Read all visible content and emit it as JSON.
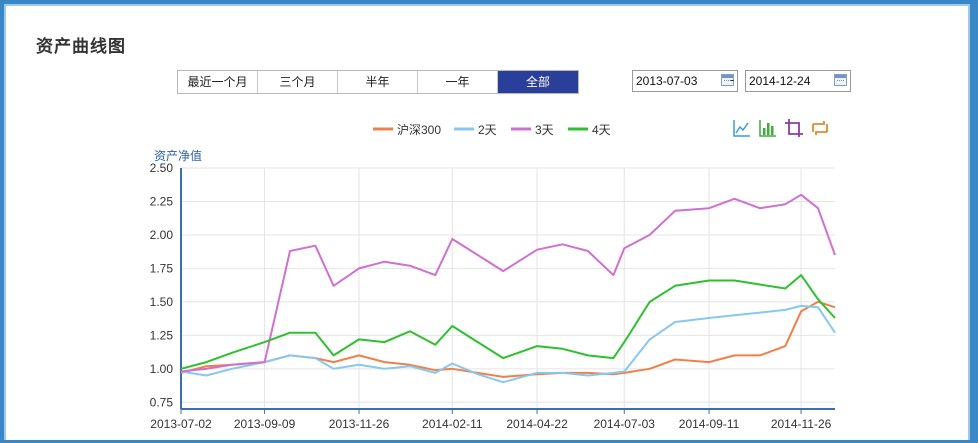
{
  "panel": {
    "title": "资产曲线图"
  },
  "range_tabs": [
    {
      "label": "最近一个月",
      "active": false
    },
    {
      "label": "三个月",
      "active": false
    },
    {
      "label": "半年",
      "active": false
    },
    {
      "label": "一年",
      "active": false
    },
    {
      "label": "全部",
      "active": true
    }
  ],
  "date_range": {
    "start": "2013-07-03",
    "separator": "-",
    "end": "2014-12-24"
  },
  "toolbox_icons": [
    "line-chart-icon",
    "bar-chart-icon",
    "stack-icon",
    "tiled-icon"
  ],
  "chart_data": {
    "type": "line",
    "ylabel": "资产净值",
    "ylim": [
      0.7,
      2.5
    ],
    "yticks": [
      "2.50",
      "2.25",
      "2.00",
      "1.75",
      "1.50",
      "1.25",
      "1.00",
      "0.75"
    ],
    "xticks": [
      "2013-07-02",
      "2013-09-09",
      "2013-11-26",
      "2014-02-11",
      "2014-04-22",
      "2014-07-03",
      "2014-09-11",
      "2014-11-26"
    ],
    "grid": true,
    "legend_position": "top-center",
    "x": [
      "2013-07-02",
      "2013-07-23",
      "2013-08-13",
      "2013-09-09",
      "2013-09-30",
      "2013-10-21",
      "2013-11-05",
      "2013-11-26",
      "2013-12-17",
      "2014-01-07",
      "2014-01-28",
      "2014-02-11",
      "2014-03-04",
      "2014-03-25",
      "2014-04-22",
      "2014-05-13",
      "2014-06-03",
      "2014-06-24",
      "2014-07-03",
      "2014-07-24",
      "2014-08-14",
      "2014-09-11",
      "2014-10-02",
      "2014-10-23",
      "2014-11-13",
      "2014-11-26",
      "2014-12-10",
      "2014-12-24"
    ],
    "series": [
      {
        "name": "沪深300",
        "color": "#f0804a",
        "values": [
          0.97,
          1.02,
          1.03,
          1.05,
          1.1,
          1.08,
          1.05,
          1.1,
          1.05,
          1.03,
          0.99,
          1.0,
          0.97,
          0.94,
          0.96,
          0.97,
          0.97,
          0.96,
          0.97,
          1.0,
          1.07,
          1.05,
          1.1,
          1.1,
          1.17,
          1.43,
          1.5,
          1.46
        ]
      },
      {
        "name": "2天",
        "color": "#87c8f0",
        "values": [
          0.98,
          0.95,
          1.0,
          1.05,
          1.1,
          1.08,
          1.0,
          1.03,
          1.0,
          1.02,
          0.97,
          1.04,
          0.96,
          0.9,
          0.97,
          0.97,
          0.95,
          0.97,
          0.98,
          1.22,
          1.35,
          1.38,
          1.4,
          1.42,
          1.44,
          1.47,
          1.46,
          1.27
        ]
      },
      {
        "name": "3天",
        "color": "#d070d0",
        "values": [
          0.98,
          1.0,
          1.03,
          1.05,
          1.88,
          1.92,
          1.62,
          1.75,
          1.8,
          1.77,
          1.7,
          1.97,
          1.85,
          1.73,
          1.89,
          1.93,
          1.88,
          1.7,
          1.9,
          2.0,
          2.18,
          2.2,
          2.27,
          2.2,
          2.23,
          2.3,
          2.2,
          1.85
        ]
      },
      {
        "name": "4天",
        "color": "#2ec02e",
        "values": [
          1.0,
          1.05,
          1.12,
          1.2,
          1.27,
          1.27,
          1.1,
          1.22,
          1.2,
          1.28,
          1.18,
          1.32,
          1.2,
          1.08,
          1.17,
          1.15,
          1.1,
          1.08,
          1.2,
          1.5,
          1.62,
          1.66,
          1.66,
          1.63,
          1.6,
          1.7,
          1.52,
          1.38
        ]
      }
    ]
  }
}
